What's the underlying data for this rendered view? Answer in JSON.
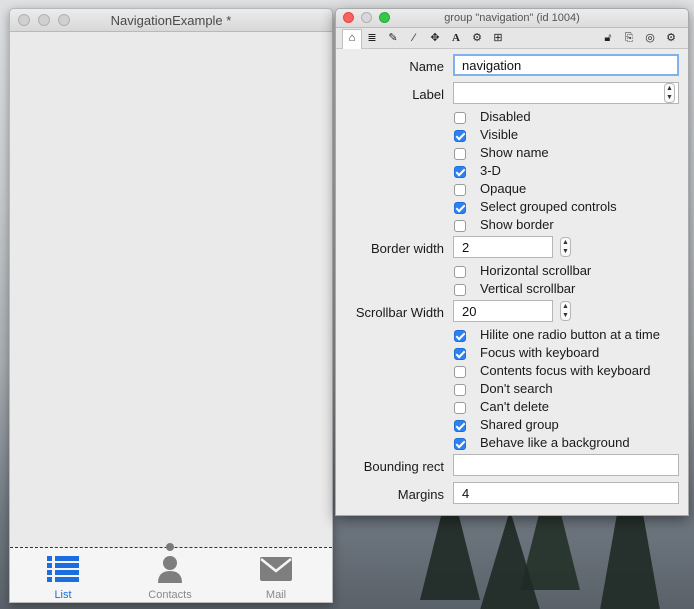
{
  "left_window": {
    "title": "NavigationExample *",
    "tabs": [
      {
        "label": "List",
        "icon": "list-icon",
        "active": true
      },
      {
        "label": "Contacts",
        "icon": "person-icon",
        "active": false
      },
      {
        "label": "Mail",
        "icon": "mail-icon",
        "active": false
      }
    ]
  },
  "inspector": {
    "title": "group \"navigation\" (id 1004)",
    "toolbar_icons": [
      "house-icon",
      "database-icon",
      "pencil-icon",
      "magic-wand-icon",
      "move-icon",
      "text-icon",
      "gears-icon",
      "grid-icon",
      "lock-icon",
      "export-icon",
      "target-icon",
      "gear-icon"
    ],
    "name_label": "Name",
    "name_value": "navigation",
    "label_label": "Label",
    "label_value": "",
    "options_group1": [
      {
        "label": "Disabled",
        "checked": false
      },
      {
        "label": "Visible",
        "checked": true
      },
      {
        "label": "Show name",
        "checked": false
      },
      {
        "label": "3-D",
        "checked": true
      },
      {
        "label": "Opaque",
        "checked": false
      },
      {
        "label": "Select grouped controls",
        "checked": true
      },
      {
        "label": "Show border",
        "checked": false
      }
    ],
    "border_width_label": "Border width",
    "border_width_value": "2",
    "options_group2": [
      {
        "label": "Horizontal scrollbar",
        "checked": false
      },
      {
        "label": "Vertical scrollbar",
        "checked": false
      }
    ],
    "scrollbar_width_label": "Scrollbar Width",
    "scrollbar_width_value": "20",
    "options_group3": [
      {
        "label": "Hilite one radio button at a time",
        "checked": true
      },
      {
        "label": "Focus with keyboard",
        "checked": true
      },
      {
        "label": "Contents focus with keyboard",
        "checked": false
      },
      {
        "label": "Don't search",
        "checked": false
      },
      {
        "label": "Can't delete",
        "checked": false
      },
      {
        "label": "Shared group",
        "checked": true
      },
      {
        "label": "Behave like a background",
        "checked": true
      }
    ],
    "bounding_rect_label": "Bounding rect",
    "bounding_rect_value": "",
    "margins_label": "Margins",
    "margins_value": "4"
  },
  "colors": {
    "accent": "#2b82f0",
    "tab_active": "#1b6de0",
    "tab_inactive": "#8a8a8a"
  }
}
